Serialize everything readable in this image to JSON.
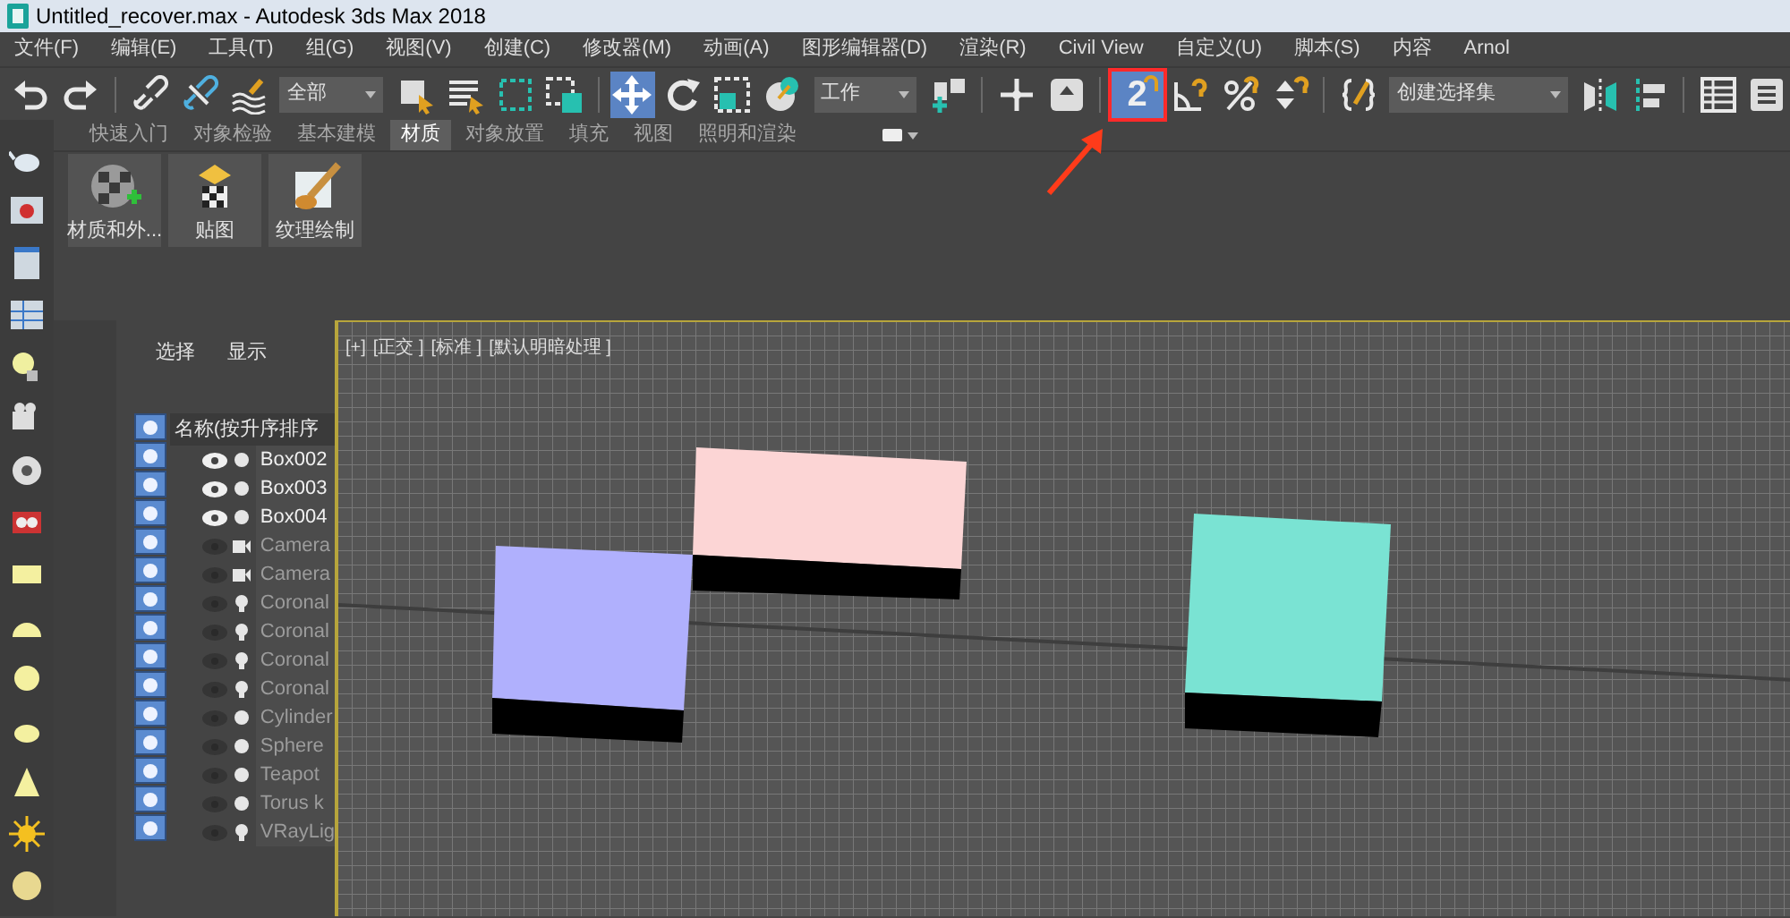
{
  "window": {
    "title": "Untitled_recover.max - Autodesk 3ds Max 2018"
  },
  "menu": [
    "文件(F)",
    "编辑(E)",
    "工具(T)",
    "组(G)",
    "视图(V)",
    "创建(C)",
    "修改器(M)",
    "动画(A)",
    "图形编辑器(D)",
    "渲染(R)",
    "Civil View",
    "自定义(U)",
    "脚本(S)",
    "内容",
    "Arnol"
  ],
  "toolbar": [
    {
      "kind": "undo",
      "on": false
    },
    {
      "kind": "redo",
      "on": false
    },
    {
      "kind": "sep"
    },
    {
      "kind": "link",
      "on": false
    },
    {
      "kind": "unlink",
      "on": false
    },
    {
      "kind": "bind",
      "on": false
    },
    {
      "kind": "dropdown",
      "value": "全部"
    },
    {
      "kind": "select",
      "on": false
    },
    {
      "kind": "select-list",
      "on": false
    },
    {
      "kind": "region",
      "on": false
    },
    {
      "kind": "crossing",
      "on": false
    },
    {
      "kind": "sep"
    },
    {
      "kind": "move",
      "on": true
    },
    {
      "kind": "rotate",
      "on": false
    },
    {
      "kind": "scale",
      "on": false
    },
    {
      "kind": "place",
      "on": false
    },
    {
      "kind": "dropdown",
      "value": "工作"
    },
    {
      "kind": "pivot",
      "on": false
    },
    {
      "kind": "sep"
    },
    {
      "kind": "manipulate",
      "on": false
    },
    {
      "kind": "shortcut",
      "on": false
    },
    {
      "kind": "sep"
    },
    {
      "kind": "snap",
      "label": "2",
      "on": true,
      "annotated": true
    },
    {
      "kind": "angle-snap",
      "on": false
    },
    {
      "kind": "percent-snap",
      "on": false
    },
    {
      "kind": "spinner-snap",
      "on": false
    },
    {
      "kind": "sep"
    },
    {
      "kind": "named-set",
      "on": false
    },
    {
      "kind": "dropdown",
      "value": "创建选择集"
    },
    {
      "kind": "mirror",
      "on": false
    },
    {
      "kind": "align",
      "on": false
    },
    {
      "kind": "sep"
    },
    {
      "kind": "table",
      "on": false
    },
    {
      "kind": "layers",
      "on": false
    }
  ],
  "ribbon": {
    "tabs": [
      {
        "label": "快速入门",
        "selected": false
      },
      {
        "label": "对象检验",
        "selected": false
      },
      {
        "label": "基本建模",
        "selected": false
      },
      {
        "label": "材质",
        "selected": true
      },
      {
        "label": "对象放置",
        "selected": false
      },
      {
        "label": "填充",
        "selected": false
      },
      {
        "label": "视图",
        "selected": false
      },
      {
        "label": "照明和渲染",
        "selected": false
      }
    ],
    "buttons": [
      {
        "kind": "material",
        "label": "材质和外..."
      },
      {
        "kind": "map",
        "label": "贴图"
      },
      {
        "kind": "paint",
        "label": "纹理绘制"
      }
    ]
  },
  "scene_explorer": {
    "tabs": [
      "选择",
      "显示"
    ],
    "column_header": "名称(按升序排序",
    "items": [
      {
        "name": "Box002",
        "kind": "geometry",
        "visible": true
      },
      {
        "name": "Box003",
        "kind": "geometry",
        "visible": true
      },
      {
        "name": "Box004",
        "kind": "geometry",
        "visible": true
      },
      {
        "name": "Camera",
        "kind": "camera",
        "visible": false
      },
      {
        "name": "Camera",
        "kind": "camera",
        "visible": false
      },
      {
        "name": "Coronal",
        "kind": "light",
        "visible": false
      },
      {
        "name": "Coronal",
        "kind": "light",
        "visible": false
      },
      {
        "name": "Coronal",
        "kind": "light",
        "visible": false
      },
      {
        "name": "Coronal",
        "kind": "light",
        "visible": false
      },
      {
        "name": "Cylinder",
        "kind": "geometry",
        "visible": false
      },
      {
        "name": "Sphere",
        "kind": "geometry",
        "visible": false
      },
      {
        "name": "Teapot",
        "kind": "geometry",
        "visible": false
      },
      {
        "name": "Torus k",
        "kind": "geometry",
        "visible": false
      },
      {
        "name": "VRayLig",
        "kind": "light",
        "visible": false
      }
    ]
  },
  "viewport": {
    "labels": [
      "[+]",
      "[正交 ]",
      "[标准 ]",
      "[默认明暗处理 ]"
    ]
  }
}
